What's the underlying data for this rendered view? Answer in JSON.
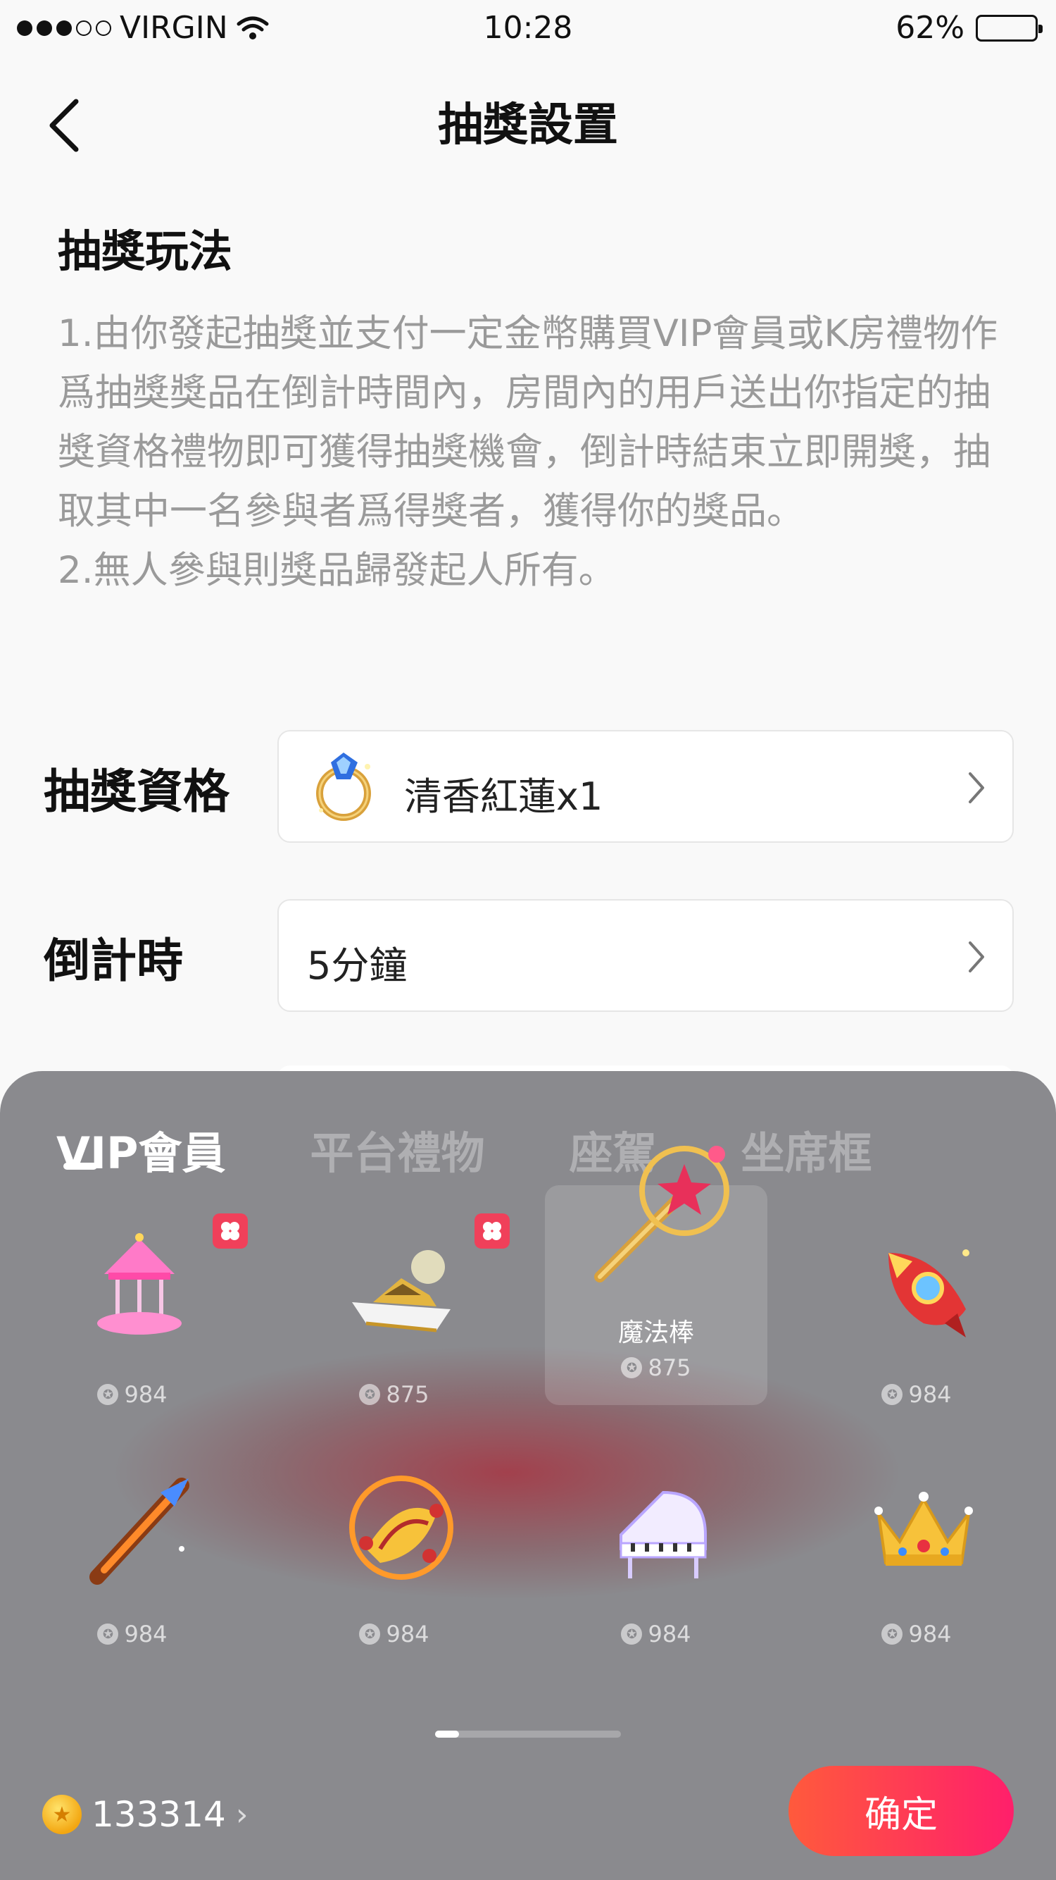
{
  "status_bar": {
    "carrier": "VIRGIN",
    "time": "10:28",
    "battery": "62%",
    "battery_level": 0.62
  },
  "nav": {
    "title": "抽獎設置"
  },
  "rules": {
    "title": "抽獎玩法",
    "paragraphs": [
      "1.由你發起抽獎並支付一定金幣購買VIP會員或K房禮物作爲抽獎獎品在倒計時間內，房間內的用戶送出你指定的抽獎資格禮物即可獲得抽獎機會，倒計時結束立即開獎，抽取其中一名參與者爲得獎者，獲得你的獎品。",
      "2.無人參與則獎品歸發起人所有。"
    ]
  },
  "form": {
    "qualification_label": "抽獎資格",
    "qualification_value": "清香紅蓮x1",
    "countdown_label": "倒計時",
    "countdown_value": "5分鐘"
  },
  "sheet": {
    "tabs": [
      {
        "label": "VIP會員",
        "active": true
      },
      {
        "label": "平台禮物",
        "active": false
      },
      {
        "label": "座駕",
        "active": false
      },
      {
        "label": "坐席框",
        "active": false
      }
    ],
    "gifts": [
      {
        "icon": "carousel-icon",
        "name": "",
        "price": "984",
        "badge": true
      },
      {
        "icon": "yacht-icon",
        "name": "",
        "price": "875",
        "badge": true
      },
      {
        "icon": "magic-wand-icon",
        "name": "魔法棒",
        "price": "875",
        "selected": true
      },
      {
        "icon": "rocket-icon",
        "name": "",
        "price": "984"
      },
      {
        "icon": "sword-icon",
        "name": "",
        "price": "984"
      },
      {
        "icon": "magic-carpet-icon",
        "name": "",
        "price": "984"
      },
      {
        "icon": "piano-icon",
        "name": "",
        "price": "984"
      },
      {
        "icon": "crown-icon",
        "name": "",
        "price": "984"
      }
    ],
    "balance": "133314",
    "confirm_label": "确定"
  },
  "colors": {
    "accent_start": "#ff5a3c",
    "accent_end": "#ff1f6b",
    "sheet": "#8a8a8e"
  }
}
